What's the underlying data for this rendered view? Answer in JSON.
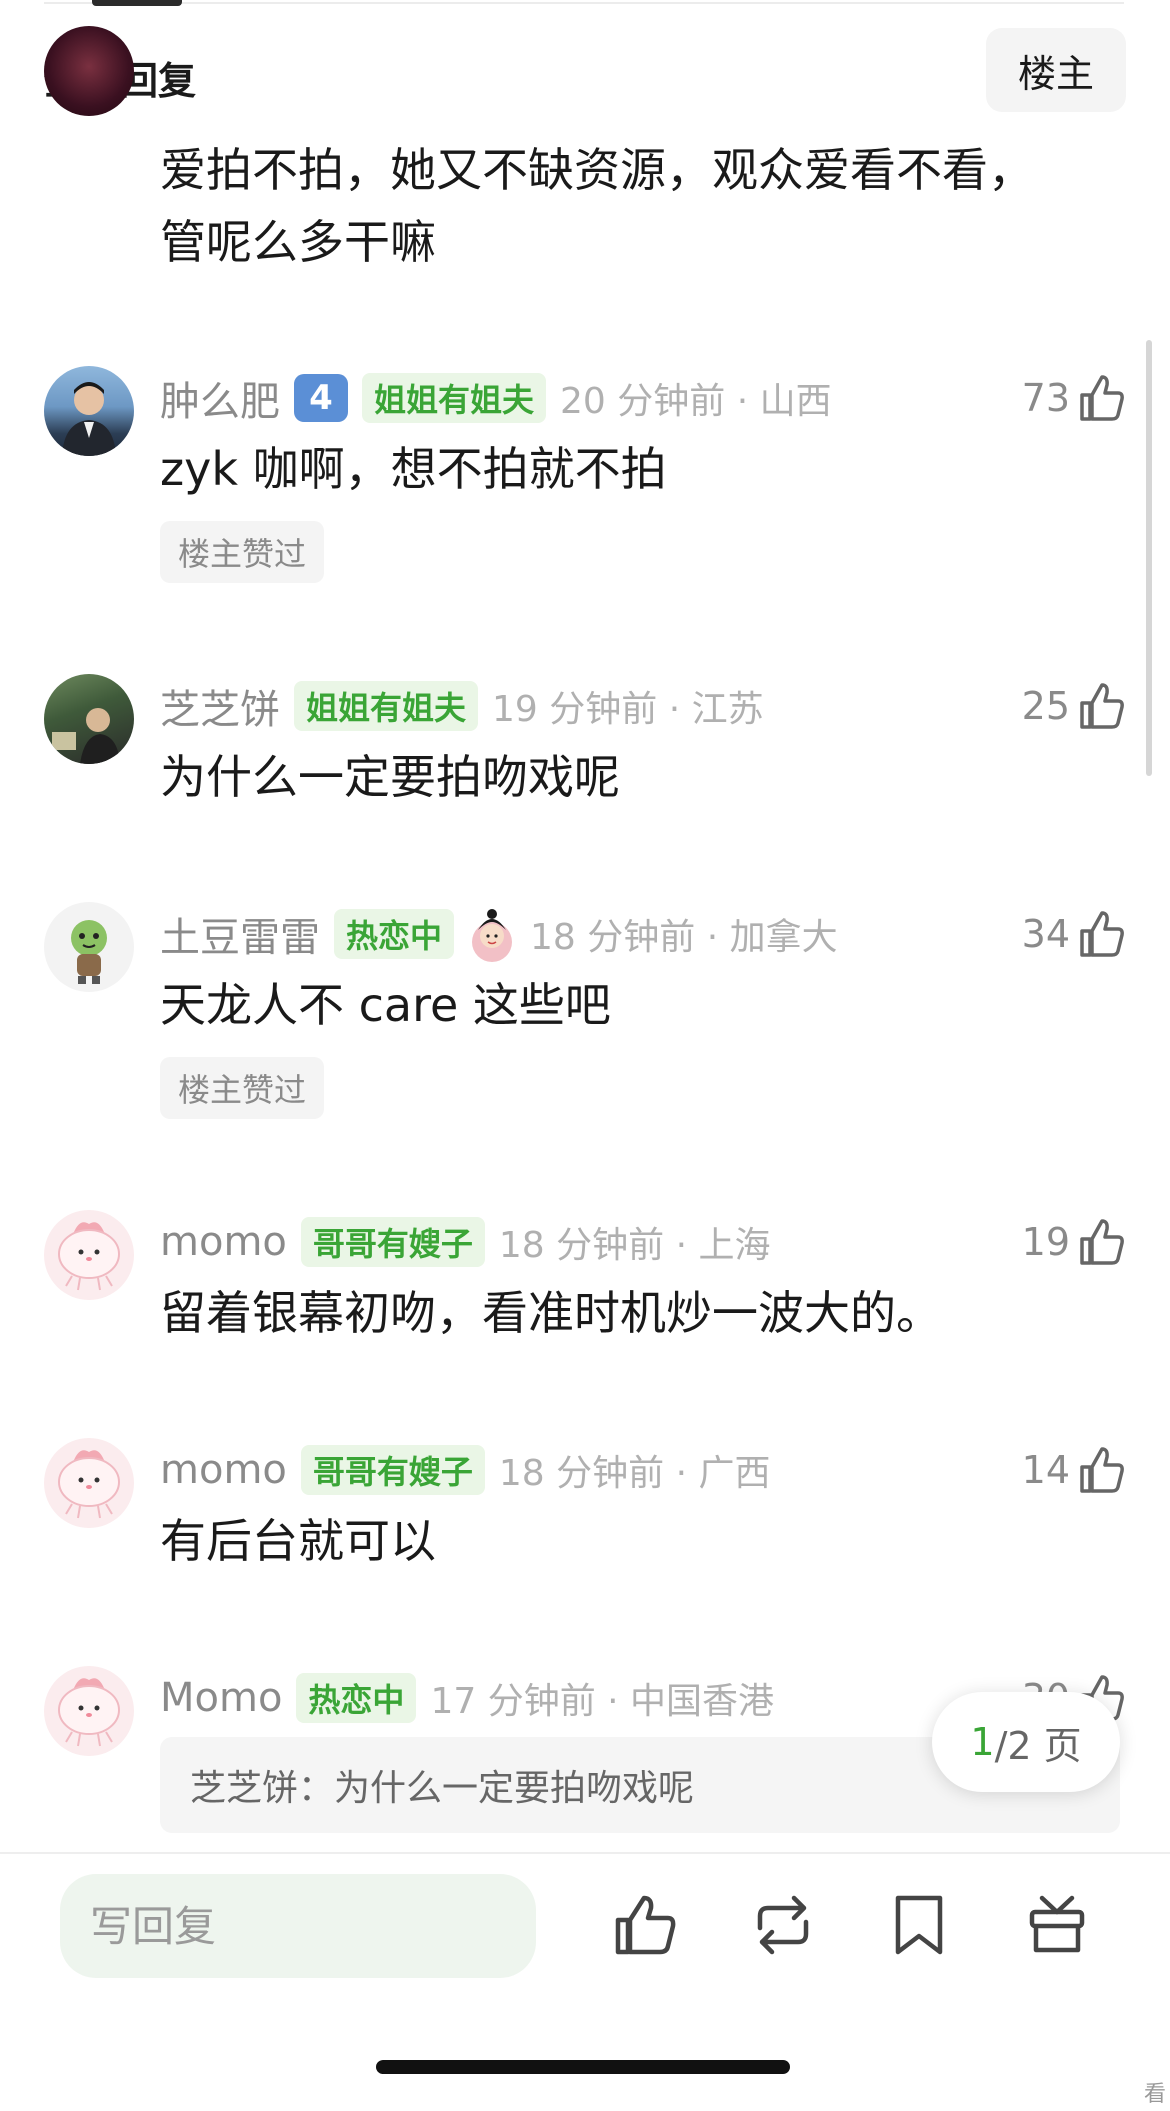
{
  "header": {
    "title": "全部回复",
    "op_button": "楼主"
  },
  "comments": [
    {
      "text_lines": [
        "爱拍不拍，她又不缺资源，观众爱看不看，",
        "管呢么多干嘛"
      ]
    },
    {
      "username": "肿么肥",
      "level": "4",
      "tag": "姐姐有姐夫",
      "time": "20 分钟前 · 山西",
      "likes": "73",
      "text": "zyk 咖啊，想不拍就不拍",
      "badge": "楼主赞过"
    },
    {
      "username": "芝芝饼",
      "tag": "姐姐有姐夫",
      "time": "19 分钟前 · 江苏",
      "likes": "25",
      "text": "为什么一定要拍吻戏呢"
    },
    {
      "username": "土豆雷雷",
      "tag": "热恋中",
      "time": "18 分钟前 · 加拿大",
      "likes": "34",
      "text": "天龙人不 care 这些吧",
      "badge": "楼主赞过"
    },
    {
      "username": "momo",
      "tag": "哥哥有嫂子",
      "time": "18 分钟前 · 上海",
      "likes": "19",
      "text": "留着银幕初吻，看准时机炒一波大的。"
    },
    {
      "username": "momo",
      "tag": "哥哥有嫂子",
      "time": "18 分钟前 · 广西",
      "likes": "14",
      "text": "有后台就可以"
    },
    {
      "username": "Momo",
      "tag": "热恋中",
      "time": "17 分钟前 · 中国香港",
      "likes": "30",
      "quote": "芝芝饼：为什么一定要拍吻戏呢"
    }
  ],
  "pager": {
    "current": "1",
    "total": "/2 页"
  },
  "bottom_bar": {
    "reply_placeholder": "写回复",
    "icons": [
      "like-icon",
      "repost-icon",
      "bookmark-icon",
      "gift-icon"
    ]
  },
  "corner_mark": "看"
}
